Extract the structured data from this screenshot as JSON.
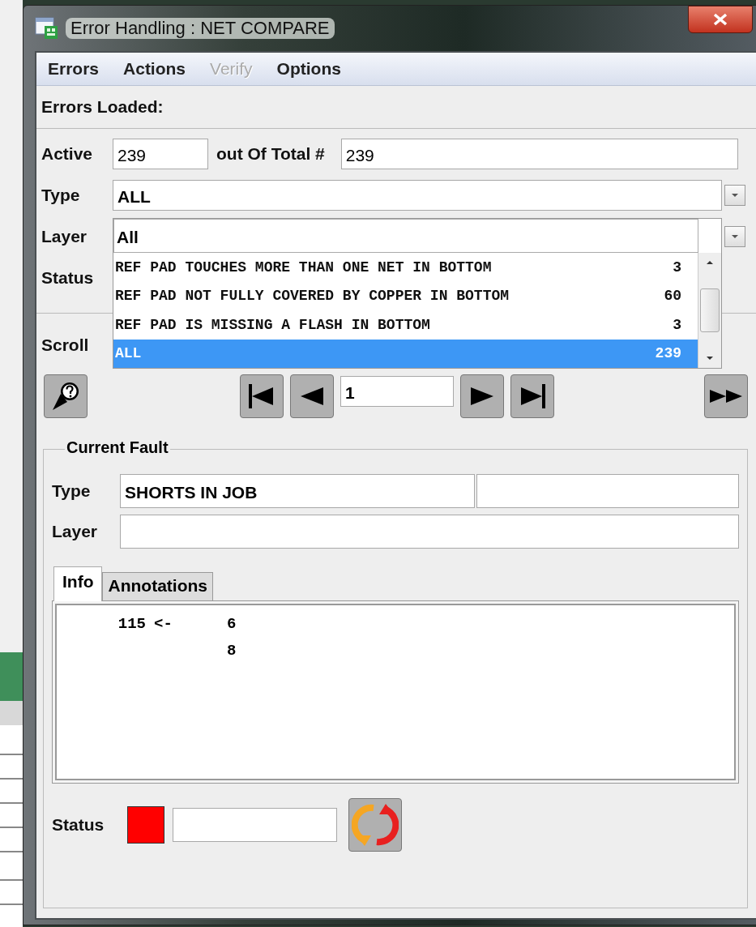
{
  "window": {
    "title": "Error Handling : NET COMPARE"
  },
  "menu": [
    {
      "label": "Errors",
      "disabled": false
    },
    {
      "label": "Actions",
      "disabled": false
    },
    {
      "label": "Verify",
      "disabled": true
    },
    {
      "label": "Options",
      "disabled": false
    }
  ],
  "errors_loaded_label": "Errors Loaded:",
  "filters": {
    "active_label": "Active",
    "active_value": "239",
    "total_label": "out Of Total #",
    "total_value": "239",
    "type_label": "Type",
    "type_value": "ALL",
    "layer_label": "Layer",
    "status_label": "Status",
    "scroll_label": "Scroll"
  },
  "layer_dropdown": {
    "value": "All",
    "items": [
      {
        "name": "REF PAD TOUCHES MORE THAN ONE NET IN BOTTOM",
        "count": "3",
        "selected": false
      },
      {
        "name": "REF PAD NOT FULLY COVERED BY COPPER IN BOTTOM",
        "count": "60",
        "selected": false
      },
      {
        "name": "REF PAD IS MISSING A FLASH IN BOTTOM",
        "count": "3",
        "selected": false
      },
      {
        "name": "ALL",
        "count": "239",
        "selected": true
      }
    ]
  },
  "navigation": {
    "page": "1"
  },
  "current_fault": {
    "title": "Current Fault",
    "type_label": "Type",
    "type_value": "SHORTS IN JOB",
    "layer_label": "Layer",
    "tabs": [
      {
        "label": "Info",
        "selected": true
      },
      {
        "label": "Annotations",
        "selected": false
      }
    ],
    "info_lines": [
      {
        "column_1": "115",
        "column_2": "<-",
        "column_3": "6"
      },
      {
        "column_3": "8"
      }
    ],
    "status_label": "Status"
  }
}
